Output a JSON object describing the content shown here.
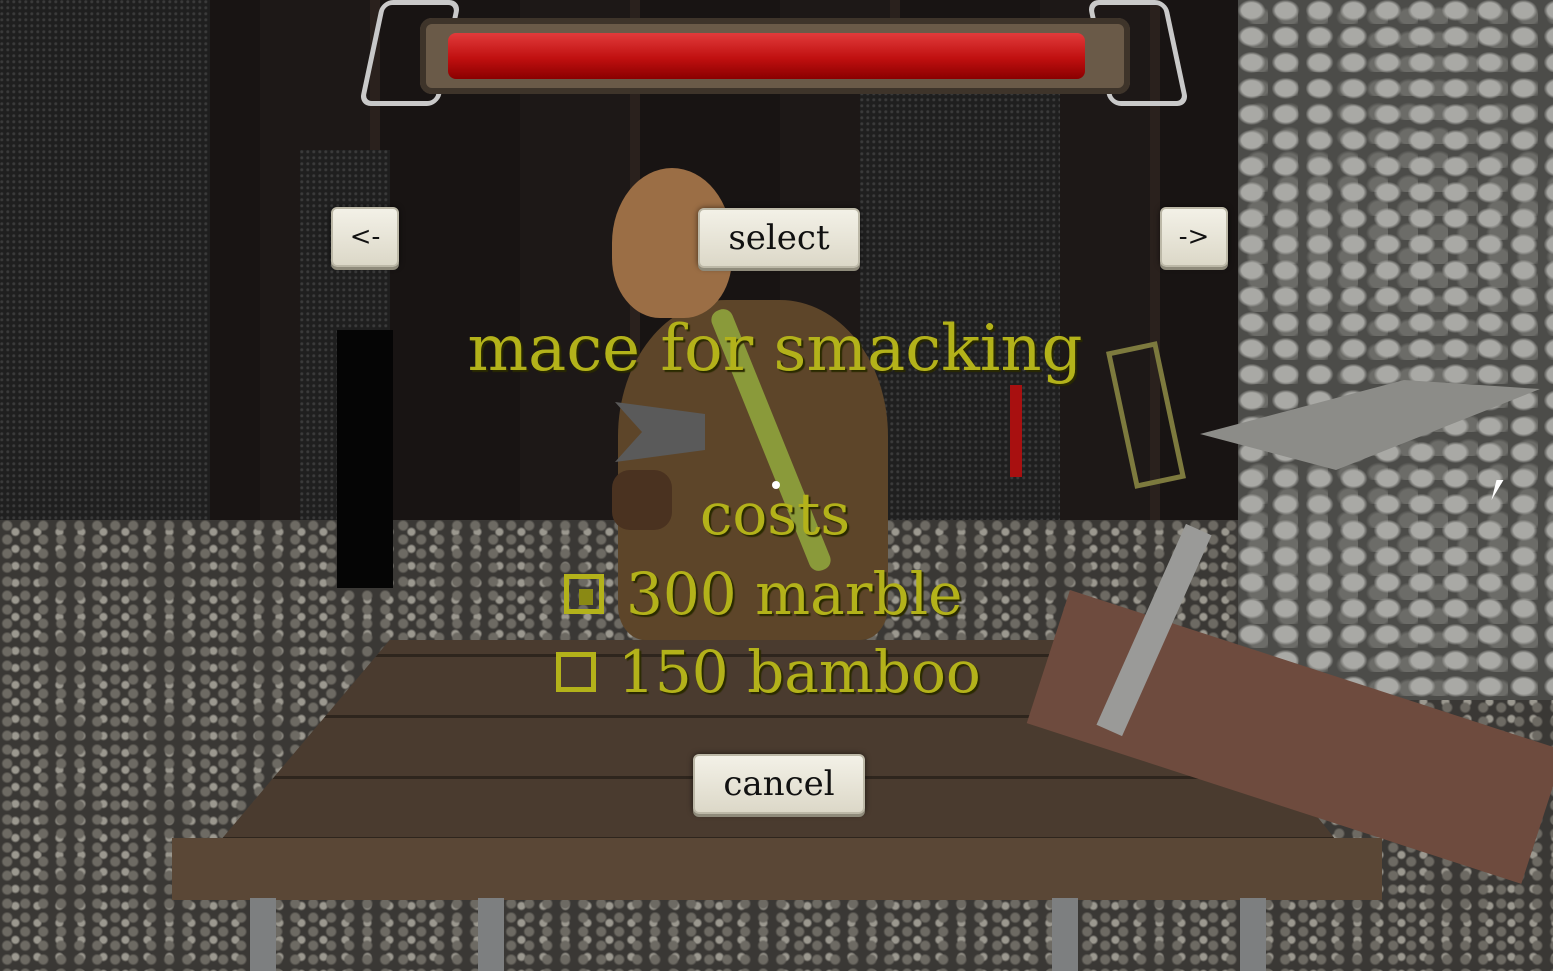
{
  "hud": {
    "health_fraction": 0.98,
    "health_color": "#c01010"
  },
  "shop": {
    "prev_label": "<-",
    "select_label": "select",
    "next_label": "->",
    "item_name": "mace for smacking",
    "costs_heading": "costs",
    "costs": [
      {
        "amount_text": "300 marble",
        "icon": "marble-icon"
      },
      {
        "amount_text": "150 bamboo",
        "icon": "bamboo-icon"
      }
    ],
    "cancel_label": "cancel"
  },
  "colors": {
    "text_accent": "#b3b21a",
    "button_face": "#ebe8da"
  }
}
